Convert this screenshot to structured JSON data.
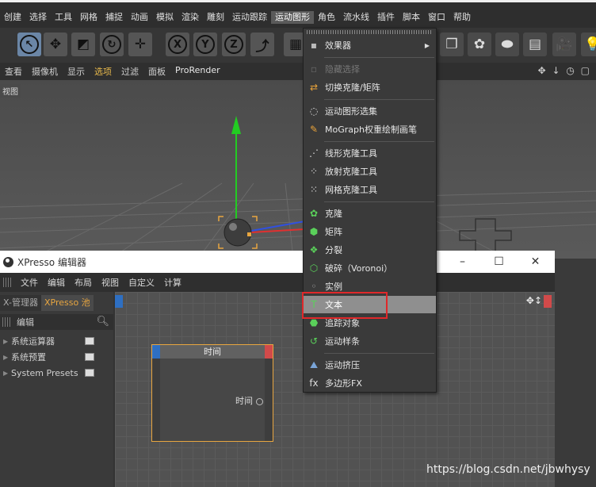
{
  "menubar": {
    "items": [
      "创建",
      "选择",
      "工具",
      "网格",
      "捕捉",
      "动画",
      "模拟",
      "渲染",
      "雕刻",
      "运动跟踪",
      "运动图形",
      "角色",
      "流水线",
      "插件",
      "脚本",
      "窗口",
      "帮助"
    ],
    "active_index": 10
  },
  "toolbar": {
    "buttons": [
      {
        "icon": "cursor-icon",
        "glyph": "↖"
      },
      {
        "icon": "move-icon",
        "glyph": "✥"
      },
      {
        "icon": "scale-icon",
        "glyph": "◩"
      },
      {
        "icon": "rotate-icon",
        "glyph": "↻"
      },
      {
        "icon": "move-alt-icon",
        "glyph": "✛"
      },
      {
        "icon": "x-axis-icon",
        "glyph": "X"
      },
      {
        "icon": "y-axis-icon",
        "glyph": "Y"
      },
      {
        "icon": "z-axis-icon",
        "glyph": "Z"
      },
      {
        "icon": "coordinate-system-icon",
        "glyph": "⤴"
      },
      {
        "icon": "render-region-icon",
        "glyph": "▦"
      },
      {
        "icon": "cube-icon",
        "glyph": "❐"
      },
      {
        "icon": "cloner-icon",
        "glyph": "✿"
      },
      {
        "icon": "deformer-icon",
        "glyph": "⬬"
      },
      {
        "icon": "floor-icon",
        "glyph": "▤"
      },
      {
        "icon": "camera-icon",
        "glyph": "🎥"
      },
      {
        "icon": "light-icon",
        "glyph": "💡"
      }
    ]
  },
  "viewmenu": {
    "items": [
      "查看",
      "摄像机",
      "显示",
      "选项",
      "过滤",
      "面板",
      "ProRender"
    ],
    "highlight_index": 3,
    "tag": "视图",
    "nav_icons": "✥ ↓ ◷ ▢"
  },
  "dropdown": {
    "items": [
      {
        "label": "效果器",
        "icon": "effector-icon",
        "glyph": "▪",
        "submenu": true,
        "disabled": false,
        "hover": false
      },
      {
        "label": "隐藏选择",
        "icon": "hide-selection-icon",
        "glyph": "▫",
        "disabled": true,
        "hover": false
      },
      {
        "label": "切换克隆/矩阵",
        "icon": "toggle-clone-icon",
        "glyph": "⇄",
        "disabled": false,
        "hover": false
      },
      {
        "label": "运动图形选集",
        "icon": "mograph-selection-icon",
        "glyph": "◌",
        "disabled": false,
        "hover": false
      },
      {
        "label": "MoGraph权重绘制画笔",
        "icon": "weight-brush-icon",
        "glyph": "✎",
        "disabled": false,
        "hover": false
      },
      {
        "label": "线形克隆工具",
        "icon": "linear-clone-icon",
        "glyph": "⋰",
        "disabled": false,
        "hover": false
      },
      {
        "label": "放射克隆工具",
        "icon": "radial-clone-icon",
        "glyph": "⁘",
        "disabled": false,
        "hover": false
      },
      {
        "label": "网格克隆工具",
        "icon": "grid-clone-icon",
        "glyph": "⁙",
        "disabled": false,
        "hover": false
      },
      {
        "label": "克隆",
        "icon": "clone-icon",
        "glyph": "✿",
        "disabled": false,
        "hover": false
      },
      {
        "label": "矩阵",
        "icon": "matrix-icon",
        "glyph": "⬢",
        "disabled": false,
        "hover": false
      },
      {
        "label": "分裂",
        "icon": "fracture-icon",
        "glyph": "❖",
        "disabled": false,
        "hover": false
      },
      {
        "label": "破碎（Voronoi）",
        "icon": "voronoi-icon",
        "glyph": "⬡",
        "disabled": false,
        "hover": false
      },
      {
        "label": "实例",
        "icon": "instance-icon",
        "glyph": "◦",
        "disabled": false,
        "hover": false
      },
      {
        "label": "文本",
        "icon": "text-icon",
        "glyph": "T",
        "disabled": false,
        "hover": true
      },
      {
        "label": "追踪对象",
        "icon": "tracer-icon",
        "glyph": "⬣",
        "disabled": false,
        "hover": false
      },
      {
        "label": "运动样条",
        "icon": "mospline-icon",
        "glyph": "↺",
        "disabled": false,
        "hover": false
      },
      {
        "label": "运动挤压",
        "icon": "moextrude-icon",
        "glyph": "⛰",
        "disabled": false,
        "hover": false
      },
      {
        "label": "多边形FX",
        "icon": "polyfx-icon",
        "glyph": "fx",
        "disabled": false,
        "hover": false
      }
    ]
  },
  "xpresso": {
    "title": "XPresso 编辑器",
    "window_controls": [
      "–",
      "☐",
      "✕"
    ],
    "menu": [
      "文件",
      "编辑",
      "布局",
      "视图",
      "自定义",
      "计算"
    ],
    "tabs": [
      "X-管理器",
      "XPresso 池"
    ],
    "active_tab": 1,
    "edit_label": "编辑",
    "pool_items": [
      "系统运算器",
      "系统预置",
      "System Presets"
    ],
    "node": {
      "title": "时间",
      "port": "时间"
    },
    "canvas_arrows": "✥↕"
  },
  "watermark": "https://blog.csdn.net/jbwhysy",
  "colors": {
    "accent": "#e8a640",
    "highlight_box": "#e0282a",
    "hover_bg": "#8f8f8f",
    "y_axis": "#22cc22",
    "x_axis": "#e03030",
    "z_axis": "#3050e0"
  }
}
